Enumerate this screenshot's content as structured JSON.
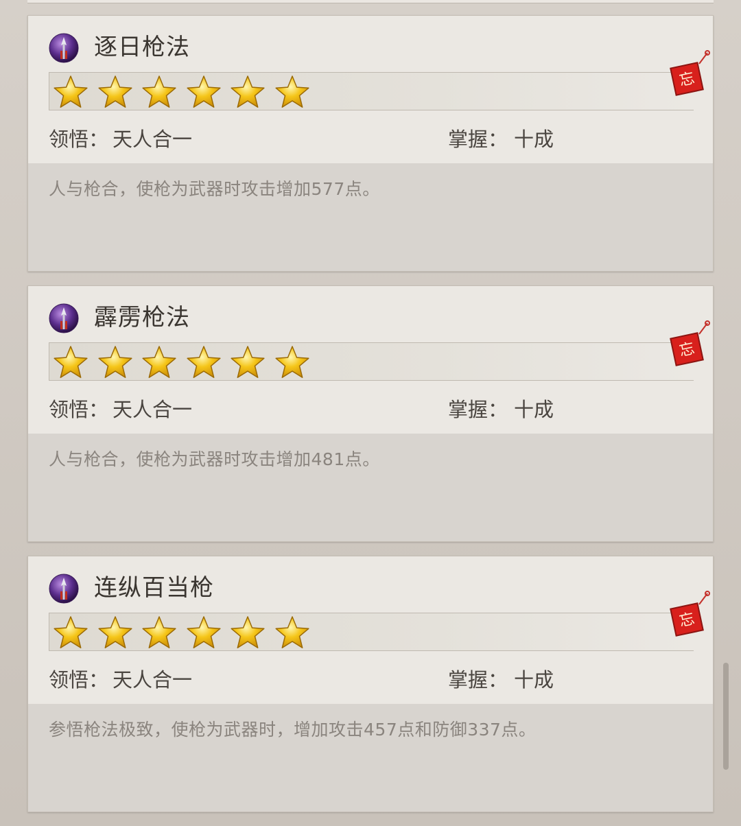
{
  "labels": {
    "comprehension": "领悟：",
    "mastery": "掌握："
  },
  "skills": [
    {
      "name": "逐日枪法",
      "stars": 6,
      "comprehension": "天人合一",
      "mastery": "十成",
      "seal": "忘",
      "description": "人与枪合，使枪为武器时攻击增加577点。"
    },
    {
      "name": "霹雳枪法",
      "stars": 6,
      "comprehension": "天人合一",
      "mastery": "十成",
      "seal": "忘",
      "description": "人与枪合，使枪为武器时攻击增加481点。"
    },
    {
      "name": "连纵百当枪",
      "stars": 6,
      "comprehension": "天人合一",
      "mastery": "十成",
      "seal": "忘",
      "description": "参悟枪法极致，使枪为武器时，增加攻击457点和防御337点。"
    }
  ],
  "icons": {
    "skill": "spear-skill-icon",
    "star": "star-icon",
    "seal": "forget-seal-icon"
  },
  "colors": {
    "star": "#f5c518",
    "seal": "#d8201c",
    "skill_icon": "#5a2d8c"
  }
}
